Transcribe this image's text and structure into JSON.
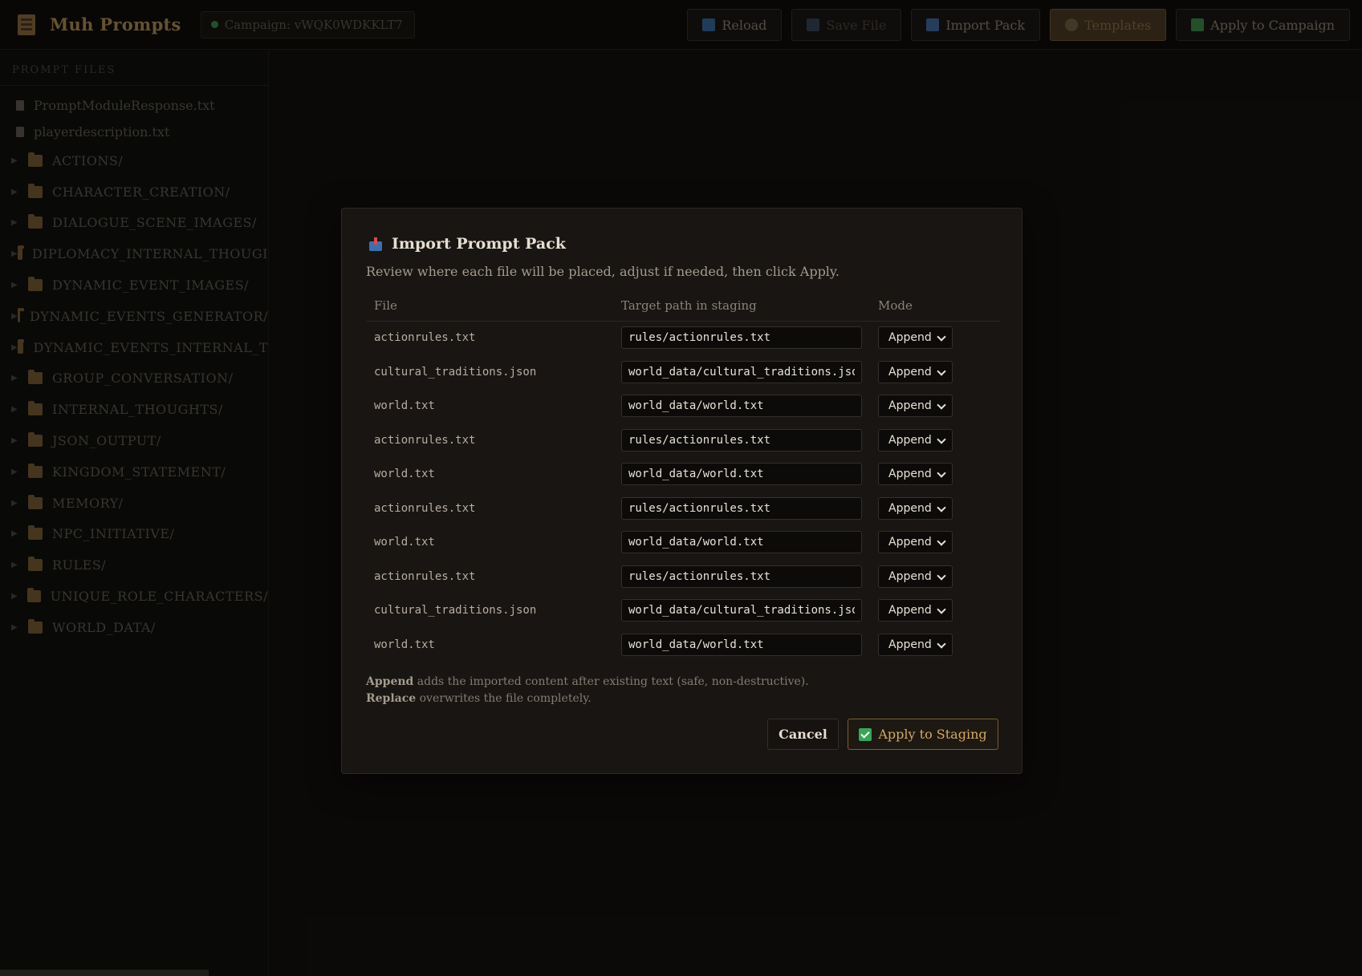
{
  "header": {
    "app_title": "Muh Prompts",
    "campaign_label": "Campaign: vWQK0WDKKLT7",
    "buttons": {
      "reload": "Reload",
      "save_file": "Save File",
      "import_pack": "Import Pack",
      "templates": "Templates",
      "apply_to_campaign": "Apply to Campaign"
    }
  },
  "sidebar": {
    "heading": "PROMPT FILES",
    "files": [
      "PromptModuleResponse.txt",
      "playerdescription.txt"
    ],
    "folders": [
      "ACTIONS/",
      "CHARACTER_CREATION/",
      "DIALOGUE_SCENE_IMAGES/",
      "DIPLOMACY_INTERNAL_THOUGI",
      "DYNAMIC_EVENT_IMAGES/",
      "DYNAMIC_EVENTS_GENERATOR/",
      "DYNAMIC_EVENTS_INTERNAL_T",
      "GROUP_CONVERSATION/",
      "INTERNAL_THOUGHTS/",
      "JSON_OUTPUT/",
      "KINGDOM_STATEMENT/",
      "MEMORY/",
      "NPC_INITIATIVE/",
      "RULES/",
      "UNIQUE_ROLE_CHARACTERS/",
      "WORLD_DATA/"
    ]
  },
  "modal": {
    "title": "Import Prompt Pack",
    "description": "Review where each file will be placed, adjust if needed, then click Apply.",
    "columns": {
      "file": "File",
      "target": "Target path in staging",
      "mode": "Mode"
    },
    "rows": [
      {
        "file": "actionrules.txt",
        "target": "rules/actionrules.txt",
        "mode": "Append"
      },
      {
        "file": "cultural_traditions.json",
        "target": "world_data/cultural_traditions.json",
        "mode": "Append"
      },
      {
        "file": "world.txt",
        "target": "world_data/world.txt",
        "mode": "Append"
      },
      {
        "file": "actionrules.txt",
        "target": "rules/actionrules.txt",
        "mode": "Append"
      },
      {
        "file": "world.txt",
        "target": "world_data/world.txt",
        "mode": "Append"
      },
      {
        "file": "actionrules.txt",
        "target": "rules/actionrules.txt",
        "mode": "Append"
      },
      {
        "file": "world.txt",
        "target": "world_data/world.txt",
        "mode": "Append"
      },
      {
        "file": "actionrules.txt",
        "target": "rules/actionrules.txt",
        "mode": "Append"
      },
      {
        "file": "cultural_traditions.json",
        "target": "world_data/cultural_traditions.json",
        "mode": "Append"
      },
      {
        "file": "world.txt",
        "target": "world_data/world.txt",
        "mode": "Append"
      }
    ],
    "note_append_term": "Append",
    "note_append_text": " adds the imported content after existing text (safe, non-destructive).",
    "note_replace_term": "Replace",
    "note_replace_text": " overwrites the file completely.",
    "cancel_label": "Cancel",
    "apply_label": "Apply to Staging"
  }
}
